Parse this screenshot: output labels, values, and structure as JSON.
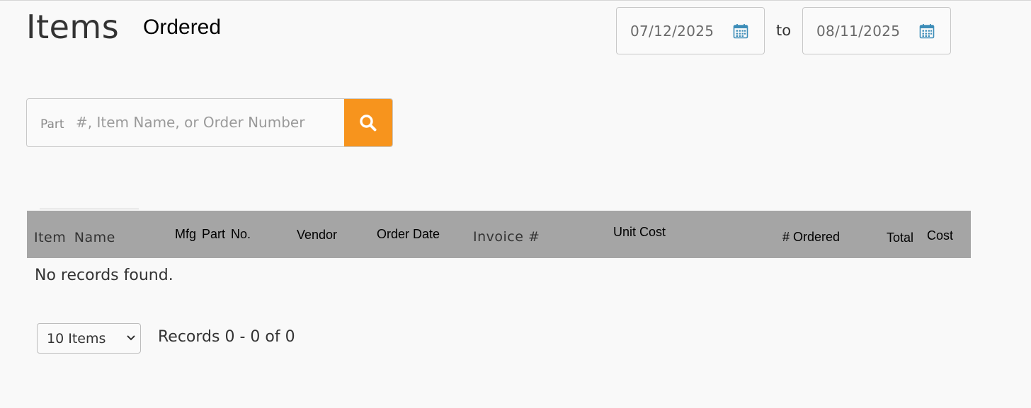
{
  "header": {
    "title": "Items",
    "subtitle": "Ordered"
  },
  "date_range": {
    "from": "07/12/2025",
    "to": "08/11/2025",
    "separator": "to"
  },
  "search": {
    "label": "Part",
    "placeholder": "#, Item Name, or Order Number",
    "button_icon": "search-icon",
    "button_color": "#f7941d"
  },
  "table": {
    "header_bg": "#a5a5a5",
    "columns": [
      "Item  Name",
      "Mfg Part  No.",
      "Vendor",
      "Order Date",
      "Invoice #",
      "Unit Cost",
      "# Ordered",
      "Total",
      "Cost"
    ],
    "empty_message": "No records found."
  },
  "pagination": {
    "page_size": "10 Items",
    "summary": "Records 0 - 0 of 0"
  }
}
